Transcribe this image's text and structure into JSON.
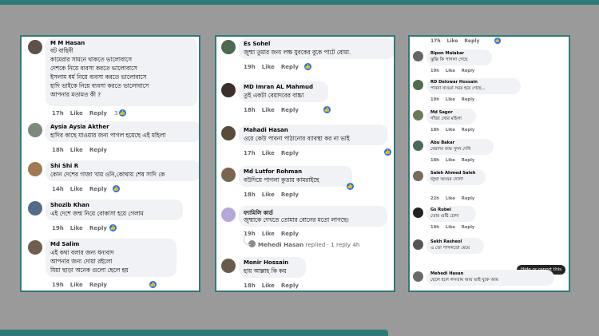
{
  "actions": {
    "like": "Like",
    "reply": "Reply"
  },
  "panel1": [
    {
      "name": "M M Hasan",
      "lines": [
        "বট বাহিনী",
        "কামেরার সামনে থাকতে ভালোবাসে",
        "দেশকে নিয়ে ব্যবসা করতে ভালোবাসে",
        "ইসলাম ধর্ম নিয়ে ব্যবসা করতে ভালোবাসে",
        "হাদি ভাইকে নিয়ে ব্যবসা করতে ভালোবাসে",
        "আপনার মতামত কী ?"
      ],
      "time": "17h",
      "reacts": "3"
    },
    {
      "name": "Aysia Aysia Akther",
      "lines": [
        "হাদির কাছে যাওয়ার জন্য পাগল হয়েছে এই মহিলা"
      ],
      "time": "18h",
      "reacts": ""
    },
    {
      "name": "Shi Shi R",
      "lines": [
        "কোন দেশের গাজা খায় ওনি,কোথায় শেষ সাদি কে"
      ],
      "time": "14h",
      "reacts": ""
    },
    {
      "name": "Shozib Khan",
      "lines": [
        "এই দেশে জন্ম নিয়ে বোকাসা হয়ে গেলাম"
      ],
      "time": "19h",
      "reacts": ""
    },
    {
      "name": "Md Salim",
      "lines": [
        "এই কথা বলার জন্য ধন্যবাদ",
        "আপনার জন্য দোয়া রইলো",
        "যিয়া ছাড়া অনেক গুলো ছেলে হয়"
      ],
      "time": "19h",
      "reacts": ""
    }
  ],
  "panel2": [
    {
      "name": "Es Sohel",
      "lines": [
        "জুম্মা তুমার জন্য লক্ষ যুবকের বুকে পাটে বোমা."
      ],
      "time": "19h",
      "reacts": ""
    },
    {
      "name": "MD Imran AL Mahmud",
      "lines": [
        "তুই একটা বেয়াদবের বাচ্চা"
      ],
      "time": "18h",
      "reacts": ""
    },
    {
      "name": "Mahadi Hasan",
      "lines": [
        "ওরে কেউ পাবনা পাঠানোর ব্যাবস্থা কর না ভাই"
      ],
      "time": "17h",
      "reacts": ""
    },
    {
      "name": "Md Lutfor Rohman",
      "lines": [
        "বউদিয়ে পাগলা কুত্তায় কামরাইছে"
      ],
      "time": "18h",
      "reacts": ""
    },
    {
      "name": "ফ্যামিলি কার্ড",
      "lines": [
        "জুম্মাকে দেখতে তোমার বোনের মতো লাগছে।"
      ],
      "time": "19h",
      "reacts": ""
    },
    {
      "name": "Monir Hossain",
      "lines": [
        "হায় আল্লাহ কি কয়"
      ],
      "time": "18h",
      "reacts": ""
    }
  ],
  "panel2_reply": {
    "author": "Mehedi Hasan",
    "text": "replied · 1 reply 4h"
  },
  "panel3_top": {
    "time": "17h"
  },
  "panel3": [
    {
      "name": "Ripon Malakar",
      "lines": [
        "ঝুক্কি কি পাগলা গেছে"
      ],
      "time": "19h"
    },
    {
      "name": "RD Delowar Hossain",
      "lines": [
        "পাবনা যাওয়া সময় হয়ে গেছে..."
      ],
      "time": "19h"
    },
    {
      "name": "Md Sagor",
      "lines": [
        "গাঁজা খোর মহিলা"
      ],
      "time": "18h"
    },
    {
      "name": "Abu Bakar",
      "lines": [
        "বেয়াদব জম্ম সুদন দেখি"
      ],
      "time": "18h"
    },
    {
      "name": "Saleh Ahmed Saleh",
      "lines": [
        "জুম্মা আগুর দোলা"
      ],
      "time": "22h"
    },
    {
      "name": "Gs Rubel",
      "lines": [
        "তোর গুষ্টি চোদা"
      ],
      "time": "19h"
    },
    {
      "name": "Sekh Rasheol",
      "lines": [
        "এ তো পাগলতো মেয়ে"
      ],
      "time": "18h"
    },
    {
      "name": "Mehedi Hasan",
      "lines": [
        "ছেলে হলে লসতাম আয় ভাই বুকে আয়"
      ],
      "time": ""
    }
  ],
  "tooltip": "Hide or report this"
}
